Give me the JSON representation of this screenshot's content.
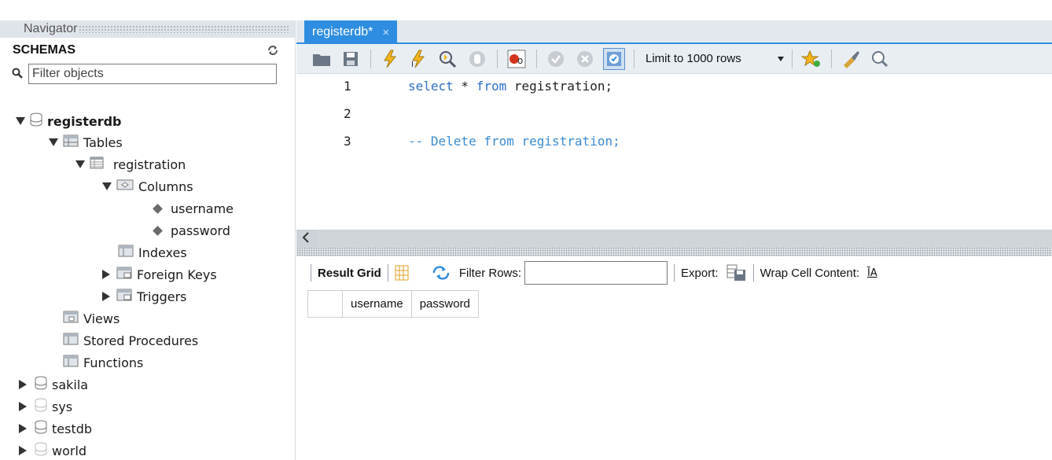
{
  "navigator": {
    "header_label": "Navigator",
    "schemas_title": "SCHEMAS",
    "filter_placeholder": "Filter objects",
    "tree": {
      "registerdb": "registerdb",
      "tables": "Tables",
      "registration": "registration",
      "columns": "Columns",
      "col_username": "username",
      "col_password": "password",
      "indexes": "Indexes",
      "foreign_keys": "Foreign Keys",
      "triggers": "Triggers",
      "views": "Views",
      "stored_procedures": "Stored Procedures",
      "functions": "Functions",
      "sakila": "sakila",
      "sys": "sys",
      "testdb": "testdb",
      "world": "world"
    }
  },
  "editor": {
    "tab_label": "registerdb*",
    "tab_close": "×",
    "limit_label": "Limit to 1000 rows",
    "lines": [
      {
        "num": "1",
        "kw1": "select",
        "mid": " * ",
        "kw2": "from",
        "rest": " registration;"
      },
      {
        "num": "2"
      },
      {
        "num": "3",
        "comment": "-- Delete from registration;"
      }
    ]
  },
  "result": {
    "result_grid_label": "Result Grid",
    "filter_rows_label": "Filter Rows:",
    "export_label": "Export:",
    "wrap_label": "Wrap Cell Content:",
    "wrap_icon_text": "ĪA",
    "columns": [
      "username",
      "password"
    ]
  },
  "colors": {
    "accent": "#2e8de0",
    "keyword": "#2c6ec7",
    "comment": "#3a8bd0"
  }
}
